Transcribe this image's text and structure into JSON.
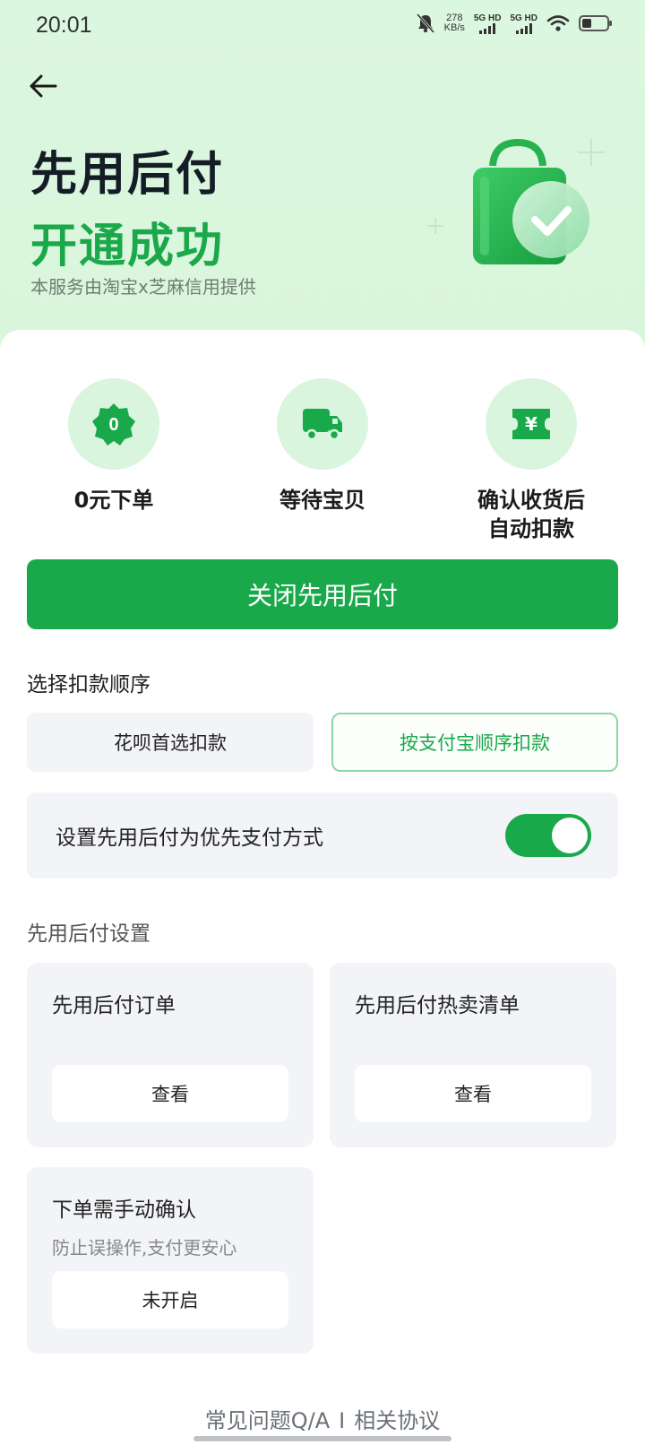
{
  "status_bar": {
    "time": "20:01",
    "net_speed_value": "278",
    "net_speed_unit": "KB/s",
    "sim1": "5G HD",
    "sim2": "5G HD"
  },
  "header": {
    "title_line1": "先用后付",
    "title_line2": "开通成功",
    "subtitle": "本服务由淘宝x芝麻信用提供"
  },
  "features": [
    {
      "icon_text": "0",
      "label": "0元下单"
    },
    {
      "label": "等待宝贝"
    },
    {
      "icon_text": "¥",
      "label": "确认收货后\n自动扣款"
    }
  ],
  "primary_button": "关闭先用后付",
  "deduct_order": {
    "label": "选择扣款顺序",
    "options": [
      "花呗首选扣款",
      "按支付宝顺序扣款"
    ],
    "selected": "按支付宝顺序扣款"
  },
  "priority_toggle": {
    "label": "设置先用后付为优先支付方式",
    "on": true
  },
  "settings": {
    "label": "先用后付设置",
    "tiles": [
      {
        "name": "先用后付订单",
        "button": "查看"
      },
      {
        "name": "先用后付热卖清单",
        "button": "查看"
      },
      {
        "name": "下单需手动确认",
        "desc": "防止误操作,支付更安心",
        "button": "未开启"
      }
    ]
  },
  "footer": {
    "faq": "常见问题Q/A",
    "separator": "I",
    "agreement": "相关协议"
  },
  "colors": {
    "accent": "#19a94a",
    "header_bg": "#dcf7df",
    "card_bg": "#f2f4f7"
  }
}
